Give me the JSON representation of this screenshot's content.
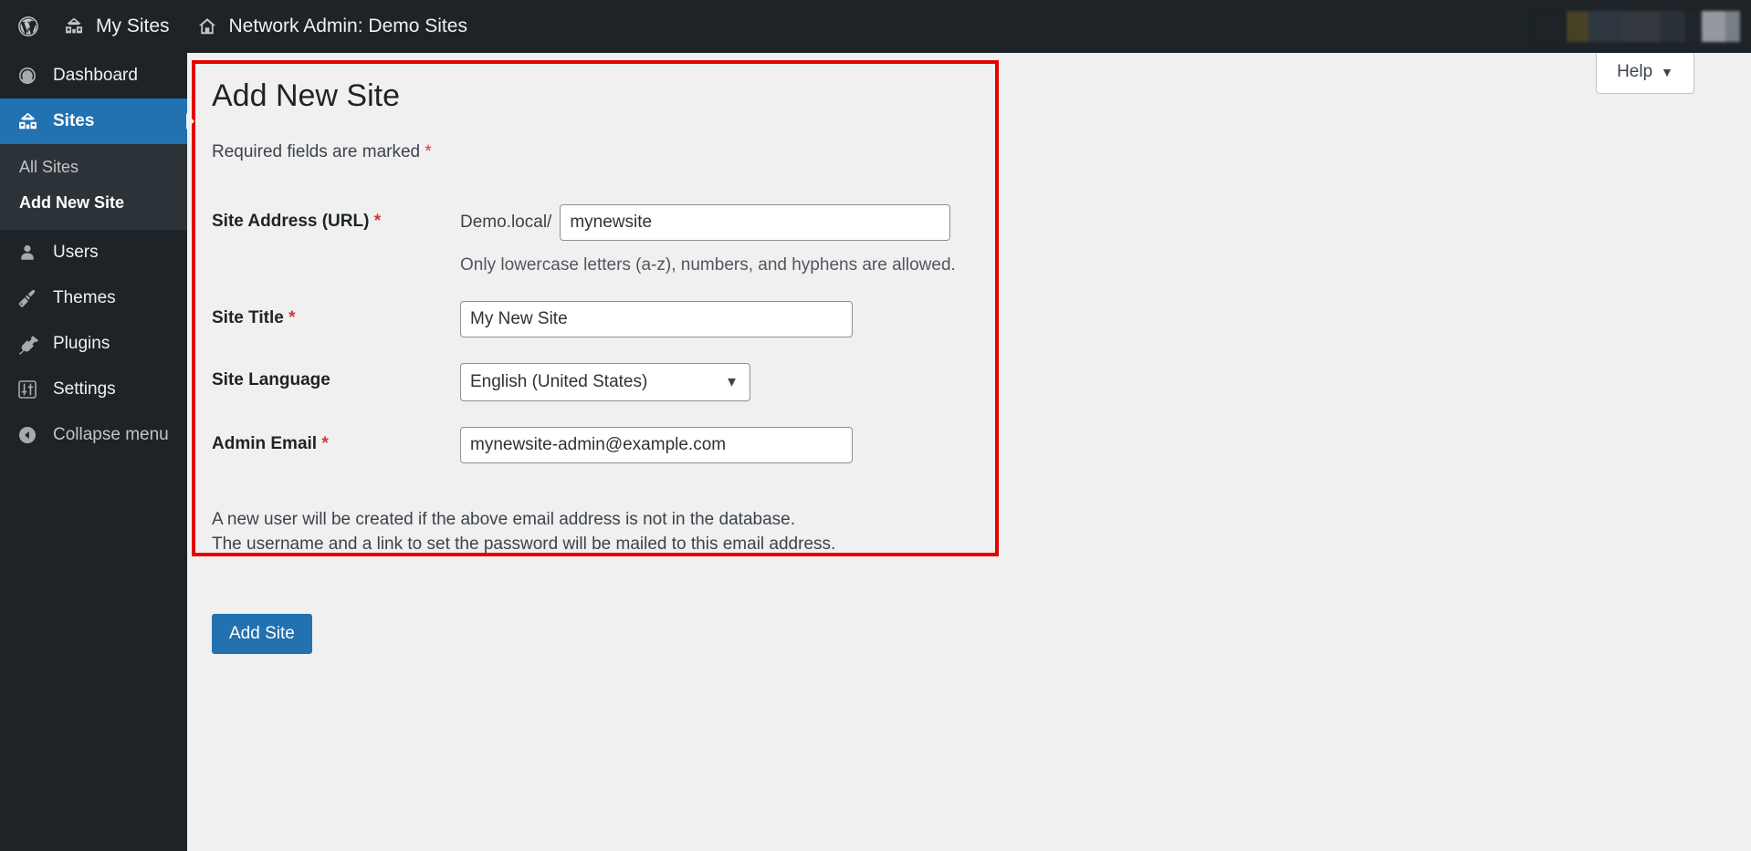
{
  "adminbar": {
    "wp_logo_icon": "wordpress-logo-icon",
    "my_sites": {
      "label": "My Sites",
      "icon": "buildings-icon"
    },
    "network_admin": {
      "label": "Network Admin: Demo Sites",
      "icon": "home-icon"
    },
    "account_area_redacted": ""
  },
  "sidebar": {
    "items": [
      {
        "label": "Dashboard",
        "icon": "dashboard-gauge-icon",
        "current": false
      },
      {
        "label": "Sites",
        "icon": "buildings-icon",
        "current": true
      },
      {
        "label": "Users",
        "icon": "user-icon",
        "current": false
      },
      {
        "label": "Themes",
        "icon": "paintbrush-icon",
        "current": false
      },
      {
        "label": "Plugins",
        "icon": "plug-icon",
        "current": false
      },
      {
        "label": "Settings",
        "icon": "sliders-icon",
        "current": false
      }
    ],
    "submenu": [
      {
        "label": "All Sites",
        "current": false
      },
      {
        "label": "Add New Site",
        "current": true
      }
    ],
    "collapse": {
      "label": "Collapse menu",
      "icon": "collapse-arrow-icon"
    }
  },
  "help_tab": {
    "label": "Help",
    "caret": "▼"
  },
  "main": {
    "title": "Add New Site",
    "required_note": "Required fields are marked",
    "required_marker": "*",
    "fields": {
      "site_address": {
        "label": "Site Address (URL)",
        "required_marker": "*",
        "prefix": "Demo.local/",
        "value": "mynewsite",
        "placeholder": "",
        "hint": "Only lowercase letters (a-z), numbers, and hyphens are allowed."
      },
      "site_title": {
        "label": "Site Title",
        "required_marker": "*",
        "value": "My New Site",
        "placeholder": ""
      },
      "site_language": {
        "label": "Site Language",
        "required_marker": "",
        "selected": "English (United States)",
        "options": [
          "English (United States)"
        ]
      },
      "admin_email": {
        "label": "Admin Email",
        "required_marker": "*",
        "value": "mynewsite-admin@example.com",
        "placeholder": ""
      }
    },
    "created_note_line1": "A new user will be created if the above email address is not in the database.",
    "created_note_line2": "The username and a link to set the password will be mailed to this email address.",
    "submit_label": "Add Site"
  },
  "colors": {
    "admin_bar": "#1d2327",
    "sidebar": "#1d2327",
    "sidebar_submenu": "#2c3338",
    "accent_blue": "#2271b1",
    "canvas": "#f0f0f1",
    "required_red": "#d63638",
    "annotation_red": "#e60000"
  }
}
